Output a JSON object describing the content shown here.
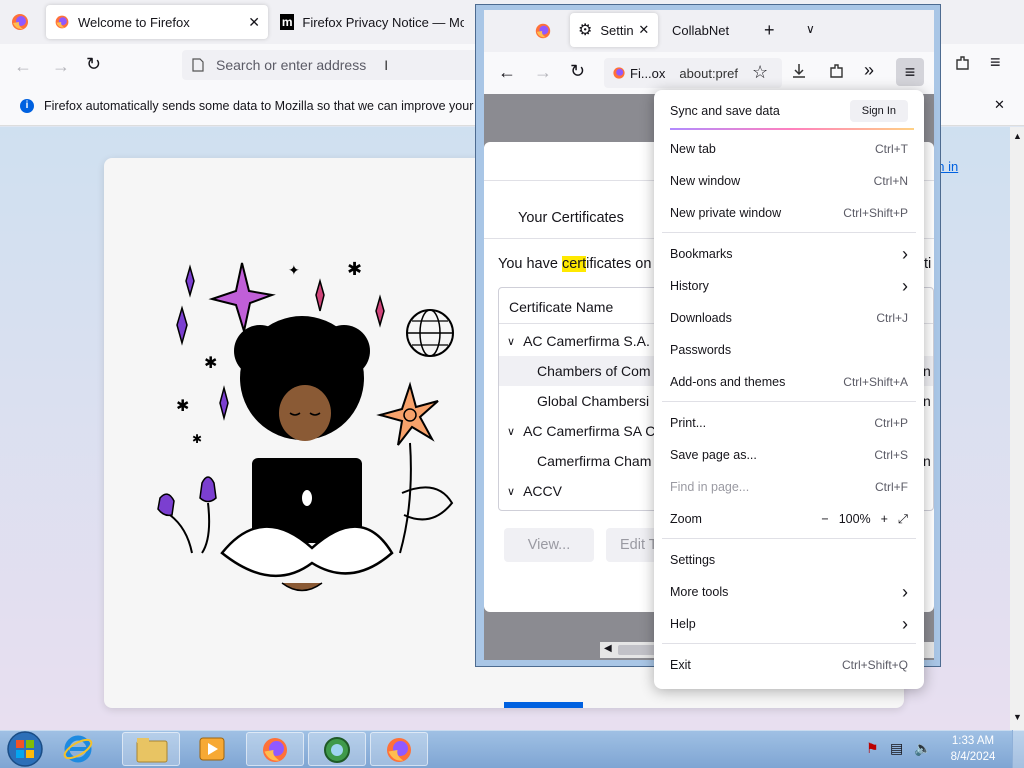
{
  "background_window": {
    "tabs": [
      {
        "label": "Welcome to Firefox"
      },
      {
        "label": "Firefox Privacy Notice — Mozill"
      }
    ],
    "url_placeholder": "Search or enter address",
    "notice": "Firefox automatically sends some data to Mozilla so that we can improve your exp",
    "sign_in_link": "gn in"
  },
  "foreground_window": {
    "tabs": [
      {
        "label": "Settings"
      },
      {
        "label": "CollabNet"
      }
    ],
    "identity_label": "Fi...ox",
    "url": "about:pref",
    "certificates": {
      "tab_label": "Your Certificates",
      "description_before": "You have ",
      "description_highlight": "cert",
      "description_after": "ificates on",
      "description_trailing": "ti",
      "column_header": "Certificate Name",
      "rows": [
        {
          "label": "AC Camerfirma S.A.",
          "type": "group",
          "trail": ""
        },
        {
          "label": "Chambers of Com",
          "type": "child",
          "trail": "n"
        },
        {
          "label": "Global Chambersi",
          "type": "child",
          "trail": "n"
        },
        {
          "label": "AC Camerfirma SA C",
          "type": "group",
          "trail": ""
        },
        {
          "label": "Camerfirma Cham",
          "type": "child",
          "trail": "n"
        },
        {
          "label": "ACCV",
          "type": "group",
          "trail": ""
        }
      ],
      "view_button": "View...",
      "edit_button": "Edit T"
    }
  },
  "app_menu": {
    "sync_label": "Sync and save data",
    "sign_in_button": "Sign In",
    "items": [
      {
        "label": "New tab",
        "shortcut": "Ctrl+T"
      },
      {
        "label": "New window",
        "shortcut": "Ctrl+N"
      },
      {
        "label": "New private window",
        "shortcut": "Ctrl+Shift+P"
      },
      {
        "label": "Bookmarks",
        "shortcut": ""
      },
      {
        "label": "History",
        "shortcut": ""
      },
      {
        "label": "Downloads",
        "shortcut": "Ctrl+J"
      },
      {
        "label": "Passwords",
        "shortcut": ""
      },
      {
        "label": "Add-ons and themes",
        "shortcut": "Ctrl+Shift+A"
      },
      {
        "label": "Print...",
        "shortcut": "Ctrl+P"
      },
      {
        "label": "Save page as...",
        "shortcut": "Ctrl+S"
      },
      {
        "label": "Find in page...",
        "shortcut": "Ctrl+F"
      },
      {
        "label": "Zoom",
        "shortcut": ""
      },
      {
        "label": "Settings",
        "shortcut": ""
      },
      {
        "label": "More tools",
        "shortcut": ""
      },
      {
        "label": "Help",
        "shortcut": ""
      },
      {
        "label": "Exit",
        "shortcut": "Ctrl+Shift+Q"
      }
    ],
    "zoom_level": "100%"
  },
  "taskbar": {
    "time": "1:33 AM",
    "date": "8/4/2024"
  },
  "colors": {
    "accent": "#0061e0",
    "highlight": "#ffe900",
    "sync_underline": "#9059ff"
  }
}
